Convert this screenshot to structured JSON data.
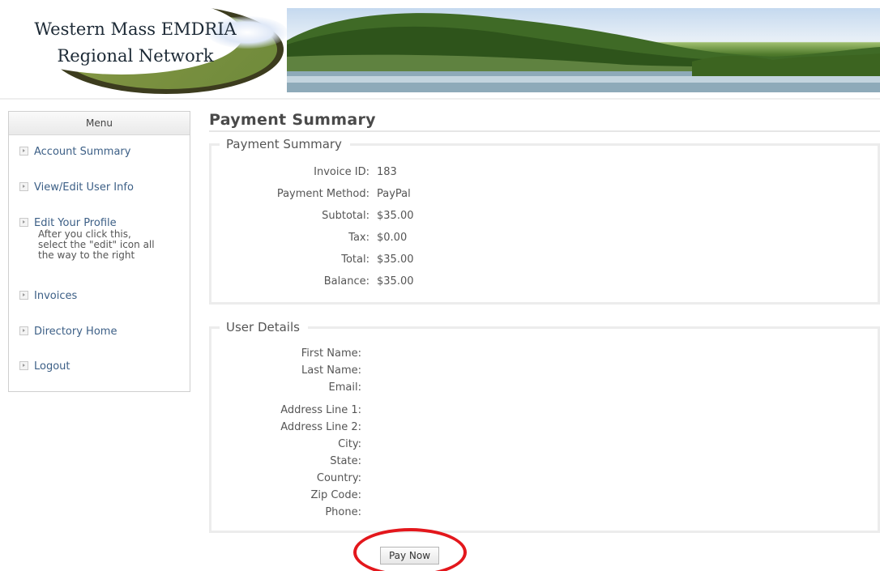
{
  "header": {
    "logo_line1": "Western Mass EMDRIA",
    "logo_line2": "Regional Network"
  },
  "sidebar": {
    "title": "Menu",
    "items": [
      {
        "label": "Account Summary"
      },
      {
        "label": "View/Edit User Info"
      },
      {
        "label": "Edit Your Profile",
        "note_lines": [
          "After you click this,",
          "select the \"edit\" icon all",
          "the way to the right"
        ]
      },
      {
        "label": "Invoices"
      },
      {
        "label": "Directory Home"
      },
      {
        "label": "Logout"
      }
    ]
  },
  "main": {
    "page_title": "Payment Summary",
    "payment_summary": {
      "legend": "Payment Summary",
      "fields": [
        {
          "label": "Invoice ID:",
          "value": "183"
        },
        {
          "label": "Payment Method:",
          "value": "PayPal"
        },
        {
          "label": "Subtotal:",
          "value": "$35.00"
        },
        {
          "label": "Tax:",
          "value": "$0.00"
        },
        {
          "label": "Total:",
          "value": "$35.00"
        },
        {
          "label": "Balance:",
          "value": "$35.00"
        }
      ]
    },
    "user_details": {
      "legend": "User Details",
      "fields": [
        {
          "label": "First Name:"
        },
        {
          "label": "Last Name:"
        },
        {
          "label": "Email:"
        },
        {
          "label": "Address Line 1:"
        },
        {
          "label": "Address Line 2:"
        },
        {
          "label": "City:"
        },
        {
          "label": "State:"
        },
        {
          "label": "Country:"
        },
        {
          "label": "Zip Code:"
        },
        {
          "label": "Phone:"
        }
      ]
    },
    "pay_button": "Pay Now"
  },
  "colors": {
    "link": "#3c5f86",
    "highlight_circle": "#e3171c",
    "logo_swoosh": "#7c9140"
  },
  "icons": {
    "menu_bullet": "arrow-right-box-icon"
  }
}
